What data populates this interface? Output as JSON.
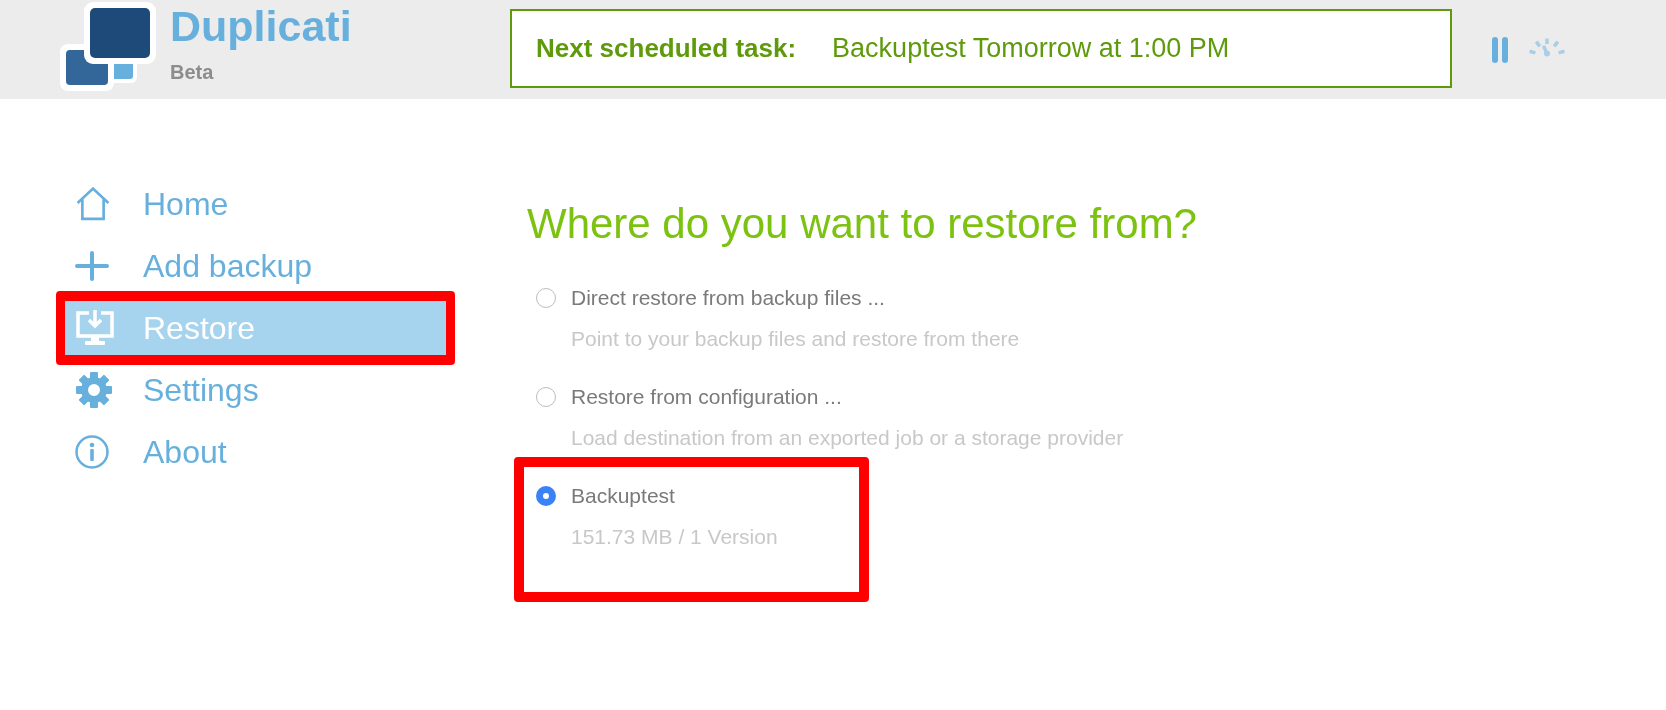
{
  "header": {
    "logo": {
      "title": "Duplicati",
      "badge": "Beta"
    },
    "schedule": {
      "label": "Next scheduled task:",
      "value": "Backuptest Tomorrow at 1:00 PM"
    }
  },
  "sidebar": {
    "items": [
      {
        "kind": "home",
        "label": "Home",
        "selected": false,
        "highlighted": false
      },
      {
        "kind": "add",
        "label": "Add backup",
        "selected": false,
        "highlighted": false
      },
      {
        "kind": "restore",
        "label": "Restore",
        "selected": true,
        "highlighted": true
      },
      {
        "kind": "settings",
        "label": "Settings",
        "selected": false,
        "highlighted": false
      },
      {
        "kind": "about",
        "label": "About",
        "selected": false,
        "highlighted": false
      }
    ]
  },
  "main": {
    "title": "Where do you want to restore from?",
    "options": [
      {
        "label": "Direct restore from backup files ...",
        "description": "Point to your backup files and restore from there",
        "selected": false,
        "highlighted": false
      },
      {
        "label": "Restore from configuration ...",
        "description": "Load destination from an exported job or a storage provider",
        "selected": false,
        "highlighted": false
      },
      {
        "label": "Backuptest",
        "description": "151.73 MB / 1 Version",
        "selected": true,
        "highlighted": true
      }
    ]
  }
}
